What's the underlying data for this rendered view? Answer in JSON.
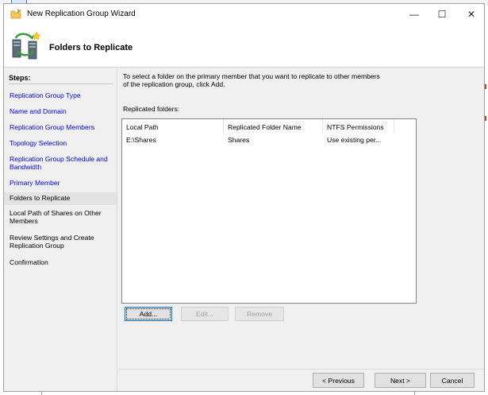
{
  "window": {
    "title": "New Replication Group Wizard",
    "controls": {
      "minimize": "—",
      "maximize": "☐",
      "close": "✕"
    }
  },
  "header": {
    "title": "Folders to Replicate",
    "icon": "replication-group-icon"
  },
  "steps": {
    "heading": "Steps:",
    "items": [
      {
        "label": "Replication Group Type",
        "state": "done"
      },
      {
        "label": "Name and Domain",
        "state": "done"
      },
      {
        "label": "Replication Group Members",
        "state": "done"
      },
      {
        "label": "Topology Selection",
        "state": "done"
      },
      {
        "label": "Replication Group Schedule and Bandwidth",
        "state": "done"
      },
      {
        "label": "Primary Member",
        "state": "done"
      },
      {
        "label": "Folders to Replicate",
        "state": "current"
      },
      {
        "label": "Local Path of Shares on Other Members",
        "state": "pending"
      },
      {
        "label": "Review Settings and Create Replication Group",
        "state": "pending"
      },
      {
        "label": "Confirmation",
        "state": "pending"
      }
    ]
  },
  "main": {
    "instructions": "To select a folder on the primary member that you want to replicate to other members of the replication group, click Add.",
    "replicated_label": "Replicated folders:",
    "columns": [
      "Local Path",
      "Replicated Folder Name",
      "NTFS Permissions"
    ],
    "rows": [
      [
        "E:\\Shares",
        "Shares",
        "Use existing per..."
      ]
    ],
    "buttons": {
      "add": "Add...",
      "edit": "Edit...",
      "remove": "Remove"
    }
  },
  "footer": {
    "previous": "< Previous",
    "next": "Next >",
    "cancel": "Cancel"
  },
  "colors": {
    "link": "#0000ff",
    "window_bg": "#f0f0f0",
    "current_step_bg": "#e3e3e3",
    "focus_border": "#0078d7"
  }
}
